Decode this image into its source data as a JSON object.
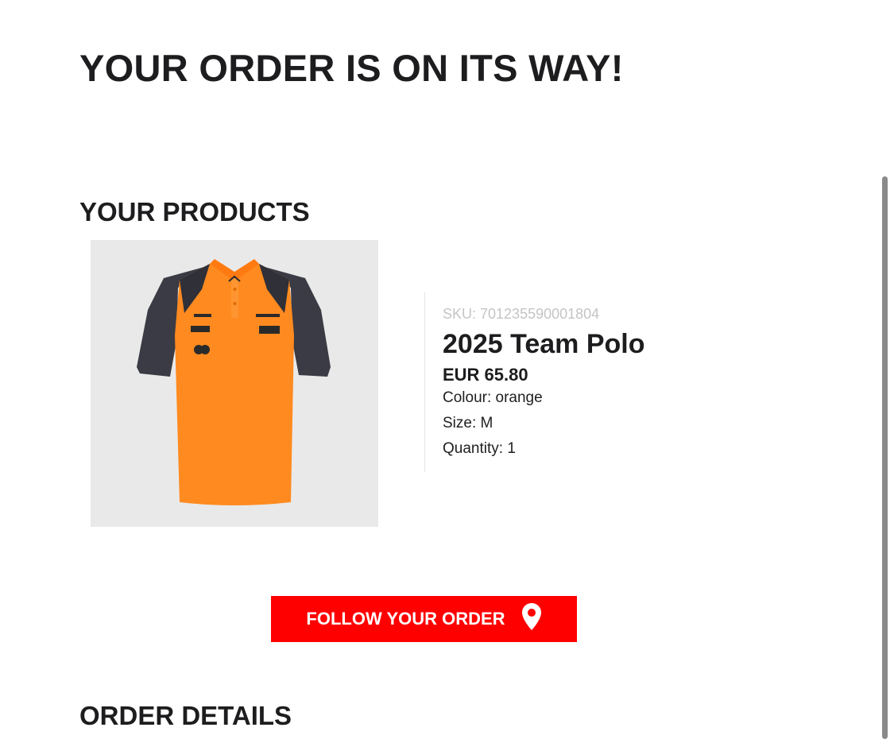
{
  "header": {
    "title": "YOUR ORDER IS ON ITS WAY!"
  },
  "products_section": {
    "title": "YOUR PRODUCTS",
    "items": [
      {
        "sku": "SKU: 701235590001804",
        "name": "2025 Team Polo",
        "price": "EUR 65.80",
        "colour": "Colour: orange",
        "size": "Size: M",
        "quantity": "Quantity: 1",
        "image_icon": "orange-team-polo-shirt"
      }
    ]
  },
  "actions": {
    "follow_order_label": "FOLLOW YOUR ORDER",
    "follow_order_icon": "map-pin-icon"
  },
  "details_section": {
    "title": "ORDER DETAILS"
  },
  "colors": {
    "accent": "#ff0000",
    "polo_body": "#ff8a1f",
    "polo_sleeve": "#3a3b44",
    "image_bg": "#e9e9e9"
  }
}
